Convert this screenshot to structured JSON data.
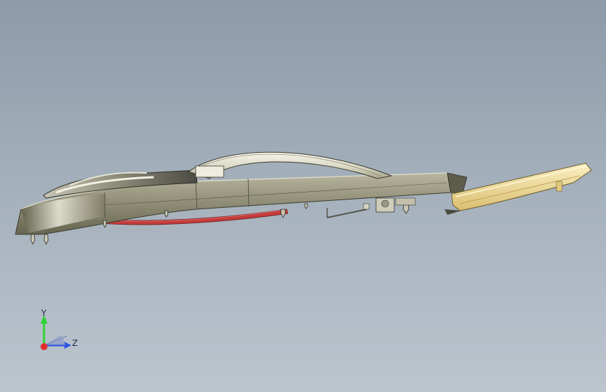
{
  "viewport": {
    "background_top": "#8d9aa8",
    "background_bottom": "#bcc5ce"
  },
  "model": {
    "body_color": "#8f8e76",
    "handle_color": "#e4e2cf",
    "lens_color": "#c43c3c",
    "cover_color": "#f1dc97"
  },
  "triad": {
    "y_label": "Y",
    "z_label": "Z",
    "y_color": "#2ed42e",
    "z_color": "#2f56e6",
    "x_color": "#e03030"
  }
}
